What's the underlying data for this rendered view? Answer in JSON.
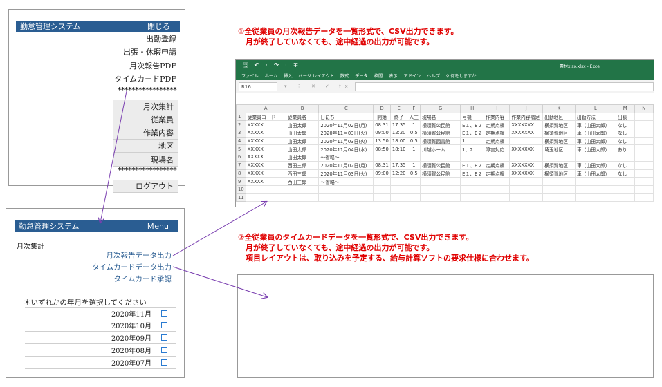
{
  "app": {
    "title": "勤怠管理システム",
    "close_label": "閉じる",
    "menu_label": "Ｍenu"
  },
  "main_menu": [
    {
      "label": "出勤登録",
      "style": "plain"
    },
    {
      "label": "出張・休暇申請",
      "style": "plain"
    },
    {
      "label": "月次報告PDF",
      "style": "plain"
    },
    {
      "label": "タイムカードPDF",
      "style": "plain"
    },
    {
      "label": "*****************",
      "style": "stars"
    },
    {
      "label": "月次集計",
      "style": "box"
    },
    {
      "label": "従業員",
      "style": "box"
    },
    {
      "label": "作業内容",
      "style": "box"
    },
    {
      "label": "地区",
      "style": "box"
    },
    {
      "label": "現場名",
      "style": "box"
    },
    {
      "label": "*****************",
      "style": "stars"
    },
    {
      "label": "ログアウト",
      "style": "box"
    }
  ],
  "monthly": {
    "section_title": "月次集計",
    "links": [
      "月次報告データ出力",
      "タイムカードデータ出力",
      "タイムカード承認"
    ],
    "prompt": "＊いずれかの年月を選択してください",
    "months": [
      "2020年11月",
      "2020年10月",
      "2020年09月",
      "2020年08月",
      "2020年07月"
    ]
  },
  "notes": {
    "note1": [
      "①全従業員の月次報告データを一覧形式で、CSV出力できます。",
      "　月が終了していなくても、途中経過の出力が可能です。"
    ],
    "note2": [
      "②全従業員のタイムカードデータを一覧形式で、CSV出力できます。",
      "　月が終了していなくても、途中経過の出力が可能です。",
      "　項目レイアウトは、取り込みを予定する、給与計算ソフトの要求仕様に合わせます。"
    ]
  },
  "excel": {
    "quick_access": "🖫 ↶ · ↷ · ∓",
    "filename": "素材xlsx.xlsx  -  Excel",
    "ribbon_tabs": [
      "ファイル",
      "ホーム",
      "挿入",
      "ページ レイアウト",
      "数式",
      "データ",
      "校閲",
      "表示",
      "アドイン",
      "ヘルプ",
      "♀ 何をしますか"
    ],
    "name_box": "R16",
    "fx_symbols": "▾ ⋮ ✕ ✓ fx",
    "columns": [
      "",
      "A",
      "B",
      "C",
      "D",
      "E",
      "F",
      "G",
      "H",
      "I",
      "J",
      "K",
      "L",
      "M",
      "N"
    ],
    "rows": [
      [
        "1",
        "従業員コード",
        "従業員名",
        "日にち",
        "開始",
        "終了",
        "人工",
        "現場名",
        "号機",
        "作業内容",
        "作業内容補足",
        "出勤地区",
        "出勤方法",
        "出張",
        ""
      ],
      [
        "2",
        "XXXXX",
        "山田太郎",
        "2020年11月02日(月)",
        "08:31",
        "17:35",
        "1",
        "横須賀公民館",
        "E１、E２",
        "定期点検",
        "XXXXXXX",
        "横須賀地区",
        "車（山田太郎）",
        "なし",
        ""
      ],
      [
        "3",
        "XXXXX",
        "山田太郎",
        "2020年11月03日(火)",
        "09:00",
        "12:20",
        "0.5",
        "横須賀公民館",
        "E１、E２",
        "定期点検",
        "XXXXXXX",
        "横須賀地区",
        "車（山田太郎）",
        "なし",
        ""
      ],
      [
        "4",
        "XXXXX",
        "山田太郎",
        "2020年11月03日(火)",
        "13:50",
        "18:00",
        "0.5",
        "横須賀図書館",
        "1",
        "定期点検",
        "",
        "横須賀地区",
        "車（山田太郎）",
        "なし",
        ""
      ],
      [
        "5",
        "XXXXX",
        "山田太郎",
        "2020年11月04日(水)",
        "08:50",
        "18:10",
        "1",
        "川越ホーム",
        "1、2",
        "障害対応",
        "XXXXXXX",
        "埼玉地区",
        "車（山田太郎）",
        "あり",
        ""
      ],
      [
        "6",
        "XXXXX",
        "山田太郎",
        "～省略～",
        "",
        "",
        "",
        "",
        "",
        "",
        "",
        "",
        "",
        "",
        ""
      ],
      [
        "7",
        "XXXXX",
        "西田三郎",
        "2020年11月02日(月)",
        "08:31",
        "17:35",
        "1",
        "横須賀公民館",
        "E１、E２",
        "定期点検",
        "XXXXXXX",
        "横須賀地区",
        "車（山田太郎）",
        "なし",
        ""
      ],
      [
        "8",
        "XXXXX",
        "西田三郎",
        "2020年11月03日(火)",
        "09:00",
        "12:20",
        "0.5",
        "横須賀公民館",
        "E１、E２",
        "定期点検",
        "XXXXXXX",
        "横須賀地区",
        "車（山田太郎）",
        "なし",
        ""
      ],
      [
        "9",
        "XXXXX",
        "西田三郎",
        "～省略～",
        "",
        "",
        "",
        "",
        "",
        "",
        "",
        "",
        "",
        "",
        ""
      ],
      [
        "10",
        "",
        "",
        "",
        "",
        "",
        "",
        "",
        "",
        "",
        "",
        "",
        "",
        "",
        ""
      ],
      [
        "11",
        "",
        "",
        "",
        "",
        "",
        "",
        "",
        "",
        "",
        "",
        "",
        "",
        "",
        ""
      ]
    ]
  },
  "colors": {
    "header_blue": "#2a5d92",
    "excel_green": "#227447",
    "note_red": "#e00000",
    "arrow_purple": "#7a3fb0"
  }
}
